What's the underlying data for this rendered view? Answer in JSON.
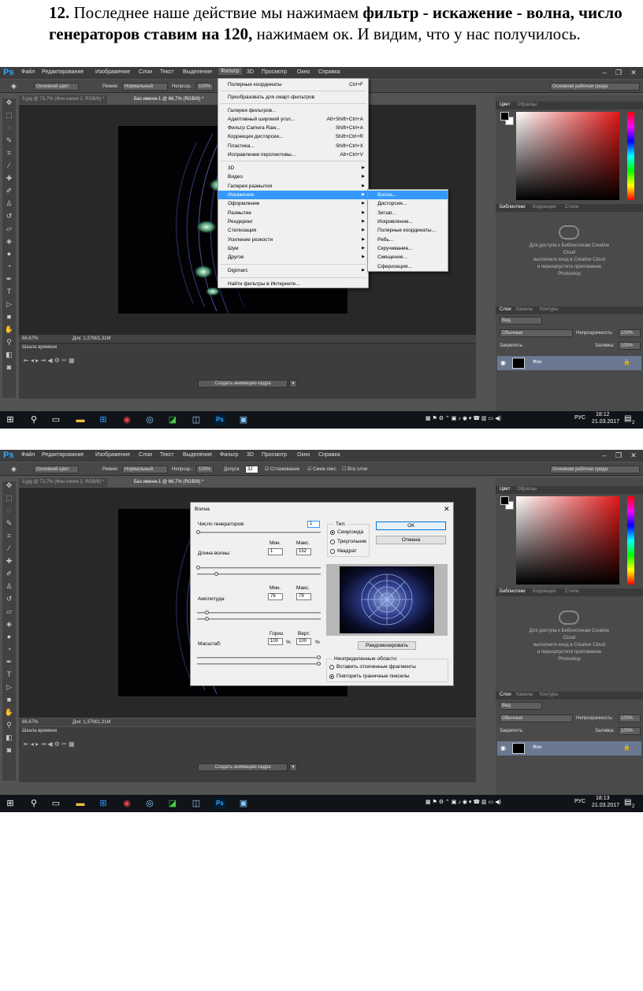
{
  "doc": {
    "num": "12.",
    "text1": " Последнее наше действие мы нажимаем ",
    "bold1": "фильтр - искажение - волна, число генераторов ставим на 120,",
    "text2": " нажимаем ок. И видим, что у нас получилось."
  },
  "menu": {
    "logo": "Ps",
    "items": [
      "Файл",
      "Редактирование",
      "Изображение",
      "Слои",
      "Текст",
      "Выделение",
      "Фильтр",
      "3D",
      "Просмотр",
      "Окно",
      "Справка"
    ]
  },
  "options": {
    "color_preset": "Основной цвет",
    "mode_label": "Режим:",
    "mode_value": "Нормальный",
    "opacity_label": "Непрозр.:",
    "opacity_value": "100%",
    "tolerance_label": "Допуск:",
    "tolerance_value": "32",
    "antialias": "Сглаживание",
    "contiguous": "Смеж.пикс",
    "all_layers": "Все слои",
    "workspace": "Основная рабочая среда"
  },
  "tabs": {
    "tab1": "3.jpg @ 73,7% (Фон копия 2, RGB/8) *",
    "tab2": "Без имени-1 @ 66,7% (RGB/8) *"
  },
  "status": {
    "zoom": "66.67%",
    "doc": "Док: 1,37M/1,31M"
  },
  "timeline": {
    "title": "Шкала времени",
    "create_anim": "Создать анимацию кадра"
  },
  "panels": {
    "color_tab": "Цвет",
    "swatches_tab": "Образцы",
    "libraries_tab": "Библиотеки",
    "adjust_tab": "Коррекция",
    "styles_tab": "Стили",
    "cc_line1": "Для доступа к Библиотекам Creative",
    "cc_line2": "Cloud",
    "cc_line3": "выполните вход в Creative Cloud",
    "cc_line4": "и перезапустите приложение",
    "cc_line5": "Photoshop",
    "layers_tab": "Слои",
    "channels_tab": "Каналы",
    "contours_tab": "Контуры",
    "kind": "Вид",
    "blend": "Обычные",
    "opacity_label": "Непрозрачность:",
    "opacity_value": "100%",
    "lock_label": "Закрепить:",
    "fill_label": "Заливка:",
    "fill_value": "100%",
    "layer_name": "Фон"
  },
  "filter_menu": {
    "items": [
      {
        "label": "Полярные координаты",
        "shortcut": "Ctrl+F"
      },
      {
        "label": "Преобразовать для смарт-фильтров",
        "shortcut": ""
      },
      {
        "label": "Галерея фильтров...",
        "shortcut": ""
      },
      {
        "label": "Адаптивный широкий угол...",
        "shortcut": "Alt+Shift+Ctrl+A"
      },
      {
        "label": "Фильтр Camera Raw...",
        "shortcut": "Shift+Ctrl+A"
      },
      {
        "label": "Коррекция дисторсии...",
        "shortcut": "Shift+Ctrl+R"
      },
      {
        "label": "Пластика...",
        "shortcut": "Shift+Ctrl+X"
      },
      {
        "label": "Исправление перспективы...",
        "shortcut": "Alt+Ctrl+V"
      },
      {
        "label": "3D",
        "shortcut": ""
      },
      {
        "label": "Видео",
        "shortcut": ""
      },
      {
        "label": "Галерея размытия",
        "shortcut": ""
      },
      {
        "label": "Искажение",
        "shortcut": ""
      },
      {
        "label": "Оформление",
        "shortcut": ""
      },
      {
        "label": "Размытие",
        "shortcut": ""
      },
      {
        "label": "Рендеринг",
        "shortcut": ""
      },
      {
        "label": "Стилизация",
        "shortcut": ""
      },
      {
        "label": "Усиление резкости",
        "shortcut": ""
      },
      {
        "label": "Шум",
        "shortcut": ""
      },
      {
        "label": "Другое",
        "shortcut": ""
      },
      {
        "label": "Digimarc",
        "shortcut": ""
      },
      {
        "label": "Найти фильтры в Интернете...",
        "shortcut": ""
      }
    ],
    "submenu": [
      "Волна...",
      "Дисторсия...",
      "Зигзаг...",
      "Искривление...",
      "Полярные координаты...",
      "Рябь...",
      "Скручивание...",
      "Смещение...",
      "Сферизация..."
    ]
  },
  "wave_dialog": {
    "title": "Волна",
    "generators_label": "Число генераторов:",
    "generators_value": "1",
    "min_label": "Мин.",
    "max_label": "Макс.",
    "wavelength_label": "Длина волны:",
    "wavelength_min": "1",
    "wavelength_max": "152",
    "amplitude_label": "Амплитуда:",
    "amplitude_min": "78",
    "amplitude_max": "79",
    "scale_label": "Масштаб:",
    "horiz_label": "Гориз.",
    "vert_label": "Верт.",
    "scale_h": "100",
    "scale_v": "100",
    "pct": "%",
    "type_label": "Тип:",
    "type_sine": "Синусоида",
    "type_triangle": "Треугольник",
    "type_square": "Квадрат",
    "ok": "ОК",
    "cancel": "Отмена",
    "randomize": "Рандомизировать",
    "undefined_label": "Неопределенные области:",
    "wrap_around": "Вставить отсеченные фрагменты",
    "repeat_edge": "Повторить граничные пикселы"
  },
  "taskbar": {
    "lang": "РУС",
    "time1": "18:12",
    "date1": "21.03.2017",
    "time2": "18:13",
    "date2": "21.03.2017",
    "notif": "2"
  }
}
